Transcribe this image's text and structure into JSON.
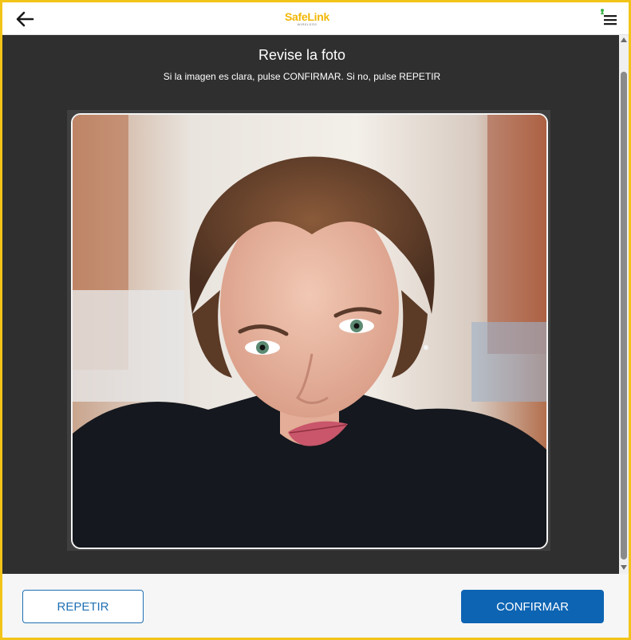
{
  "header": {
    "back_icon": "arrow-left-icon",
    "logo": {
      "text": "SafeLink",
      "subtitle": "WIRELESS"
    },
    "menu_icon": "hamburger-menu-icon",
    "notification_dot_color": "#3db24b"
  },
  "main": {
    "title": "Revise la foto",
    "instruction": "Si la imagen es clara, pulse CONFIRMAR. Si no, pulse REPETIR",
    "photo_description": "selfie-photo"
  },
  "footer": {
    "retake_label": "REPETIR",
    "confirm_label": "CONFIRMAR"
  },
  "colors": {
    "accent": "#0d64b3",
    "frame": "#f2c418",
    "logo": "#f2b705",
    "content_background": "#2f2f2f"
  }
}
